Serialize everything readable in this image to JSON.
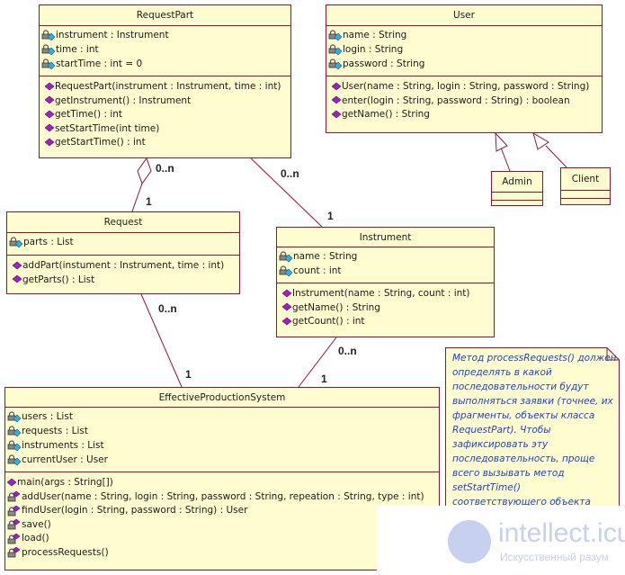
{
  "classes": {
    "request_part": {
      "name": "RequestPart",
      "attributes": [
        "instrument : Instrument",
        "time : int",
        "startTime : int = 0"
      ],
      "operations": [
        "RequestPart(instrument : Instrument, time : int)",
        "getInstrument() : Instrument",
        "getTime() : int",
        "setStartTime(int time)",
        "getStartTime() : int"
      ]
    },
    "user": {
      "name": "User",
      "attributes": [
        "name : String",
        "login : String",
        "password : String"
      ],
      "operations": [
        "User(name : String, login : String, password : String)",
        "enter(login : String, password : String) : boolean",
        "getName() : String"
      ]
    },
    "admin": {
      "name": "Admin"
    },
    "client": {
      "name": "Client"
    },
    "request": {
      "name": "Request",
      "attributes": [
        "parts : List"
      ],
      "operations": [
        "addPart(instument : Instrument, time : int)",
        "getParts() : List"
      ]
    },
    "instrument": {
      "name": "Instrument",
      "attributes": [
        "name : String",
        "count : int"
      ],
      "operations": [
        "Instrument(name : String, count : int)",
        "getName() : String",
        "getCount() : int"
      ]
    },
    "eps": {
      "name": "EffectiveProductionSystem",
      "attributes": [
        "users : List",
        "requests : List",
        "instruments : List",
        "currentUser : User"
      ],
      "operations": [
        "main(args : String[])",
        "addUser(name : String, login : String, password : String, repeation : String, type : int)",
        "findUser(login : String, password : String) : User",
        "save()",
        "load()",
        "processRequests()"
      ],
      "operation_visibility": [
        "public",
        "private",
        "private",
        "private",
        "private",
        "private"
      ]
    }
  },
  "associations": {
    "requestpart_request": {
      "source_mult": "0..n",
      "target_mult": "1",
      "kind": "aggregation"
    },
    "requestpart_instrument": {
      "source_mult": "0..n",
      "target_mult": "1"
    },
    "request_eps": {
      "source_mult": "0..n",
      "target_mult": "1"
    },
    "instrument_eps": {
      "source_mult": "0..n",
      "target_mult": "1"
    }
  },
  "generalizations": [
    "Admin -> User",
    "Client -> User"
  ],
  "note": {
    "text": "Метод processRequests() должен определять в какой последовательности будут выполняться заявки (точнее, их фрагменты, объекты класса RequestPart). Чтобы зафиксировать эту последовательность, проще всего вызывать метод setStartTime() соответствующего объекта"
  },
  "watermark": {
    "brand": "intellect.icu",
    "tagline": "Искусственный разум"
  },
  "colors": {
    "class_fill": "#fffdd0",
    "class_border": "#8a1538",
    "note_text": "#1f3fc8",
    "op_icon": "#a020c0",
    "attr_icon": "#30b0e0"
  }
}
